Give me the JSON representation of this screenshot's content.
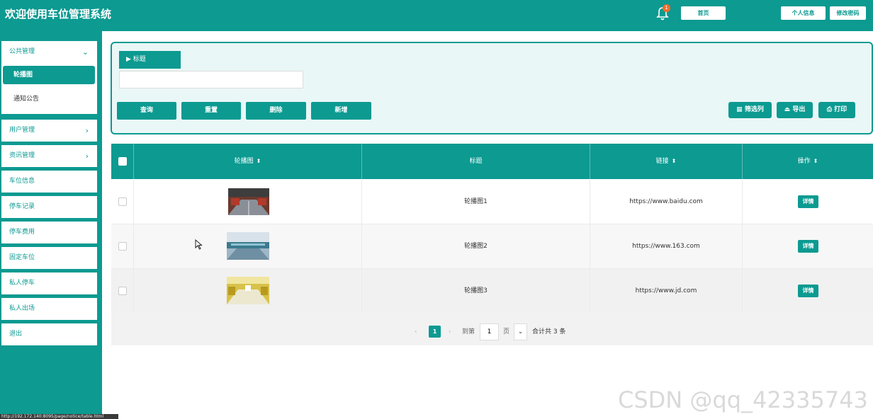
{
  "header": {
    "title": "欢迎使用车位管理系统",
    "notification_count": "1",
    "buttons": {
      "home": "首页",
      "profile": "个人信息",
      "password": "修改密码"
    }
  },
  "sidebar": {
    "groups": [
      {
        "label": "公共管理",
        "children": [
          "轮播图",
          "通知公告"
        ]
      }
    ],
    "items": [
      "用户管理",
      "资讯管理",
      "车位信息",
      "停车记录",
      "停车费用",
      "固定车位",
      "私人停车",
      "私人出场",
      "退出"
    ]
  },
  "search": {
    "title_label": "标题",
    "title_value": "",
    "buttons": {
      "query": "查询",
      "reset": "重置",
      "delete": "删除",
      "add": "新增"
    },
    "tools": {
      "columns": "筛选列",
      "export": "导出",
      "print": "打印"
    }
  },
  "table": {
    "headers": {
      "image": "轮播图",
      "title": "标题",
      "link": "链接",
      "action": "操作"
    },
    "rows": [
      {
        "title": "轮播图1",
        "link": "https://www.baidu.com",
        "action": "详情"
      },
      {
        "title": "轮播图2",
        "link": "https://www.163.com",
        "action": "详情"
      },
      {
        "title": "轮播图3",
        "link": "https://www.jd.com",
        "action": "详情"
      }
    ]
  },
  "pagination": {
    "current_page": "1",
    "goto_label": "到第",
    "goto_value": "1",
    "page_unit": "页",
    "total": "合计共 3 条"
  },
  "watermark": "CSDN @qq_42335743",
  "status_url": "http://192.172.140:8095/page/notice/table.html",
  "colors": {
    "accent": "#0c9a91"
  }
}
